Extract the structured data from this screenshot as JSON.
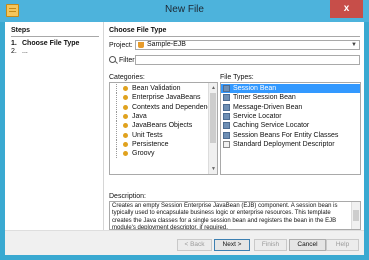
{
  "window": {
    "title": "New File",
    "close_glyph": "x"
  },
  "steps": {
    "title": "Steps",
    "items": [
      {
        "num": "1.",
        "label": "Choose File Type"
      },
      {
        "num": "2.",
        "label": "..."
      }
    ]
  },
  "main": {
    "title": "Choose File Type",
    "project_label": "Project:",
    "project_value": "Sample-EJB",
    "filter_label": "Filter:",
    "filter_value": "",
    "categories_label": "Categories:",
    "filetypes_label": "File Types:",
    "categories": [
      {
        "label": "Bean Validation",
        "selected": false
      },
      {
        "label": "Enterprise JavaBeans",
        "selected": false
      },
      {
        "label": "Contexts and Dependency",
        "selected": false
      },
      {
        "label": "Java",
        "selected": false
      },
      {
        "label": "JavaBeans Objects",
        "selected": false
      },
      {
        "label": "Unit Tests",
        "selected": false
      },
      {
        "label": "Persistence",
        "selected": false
      },
      {
        "label": "Groovy",
        "selected": false
      }
    ],
    "file_types": [
      {
        "label": "Session Bean",
        "selected": true,
        "icon": "bean-icon"
      },
      {
        "label": "Timer Session Bean",
        "selected": false,
        "icon": "bean-icon"
      },
      {
        "label": "Message-Driven Bean",
        "selected": false,
        "icon": "bean-icon"
      },
      {
        "label": "Service Locator",
        "selected": false,
        "icon": "bean-icon"
      },
      {
        "label": "Caching Service Locator",
        "selected": false,
        "icon": "bean-icon"
      },
      {
        "label": "Session Beans For Entity Classes",
        "selected": false,
        "icon": "bean-icon"
      },
      {
        "label": "Standard Deployment Descriptor",
        "selected": false,
        "icon": "document-icon"
      }
    ],
    "description_label": "Description:",
    "description_text": "Creates an empty Session Enterprise JavaBean (EJB) component. A session bean is typically used to encapsulate business logic or enterprise resources. This template creates the Java classes for a single session bean and registers the bean in the EJB module's deployment descriptor, if required."
  },
  "footer": {
    "back": "< Back",
    "next": "Next >",
    "finish": "Finish",
    "cancel": "Cancel",
    "help": "Help"
  },
  "colors": {
    "title_bar": "#4db3dc",
    "close_button": "#c74e49",
    "selection": "#3399ff"
  }
}
